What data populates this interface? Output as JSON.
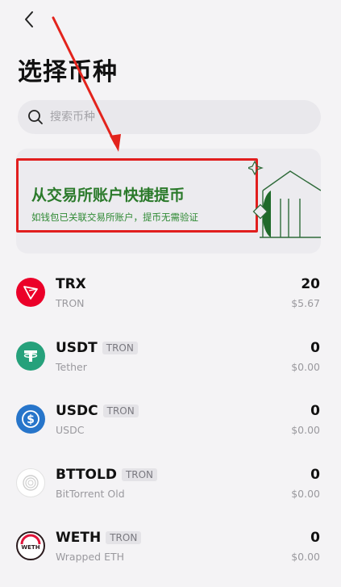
{
  "header": {
    "title": "选择币种"
  },
  "search": {
    "placeholder": "搜索币种"
  },
  "banner": {
    "title": "从交易所账户快捷提币",
    "subtitle": "如钱包已关联交易所账户，提币无需验证",
    "highlight_color": "#e11e1e",
    "text_color": "#2b7a2b"
  },
  "tokens": [
    {
      "symbol": "TRX",
      "chain": "",
      "name": "TRON",
      "amount": "20",
      "value": "$5.67",
      "icon": "tron-icon",
      "color": "#eb0029"
    },
    {
      "symbol": "USDT",
      "chain": "TRON",
      "name": "Tether",
      "amount": "0",
      "value": "$0.00",
      "icon": "tether-icon",
      "color": "#26a17b"
    },
    {
      "symbol": "USDC",
      "chain": "TRON",
      "name": "USDC",
      "amount": "0",
      "value": "$0.00",
      "icon": "usdc-icon",
      "color": "#2775ca"
    },
    {
      "symbol": "BTTOLD",
      "chain": "TRON",
      "name": "BitTorrent Old",
      "amount": "0",
      "value": "$0.00",
      "icon": "bittorrent-icon",
      "color": "#d8d8d8"
    },
    {
      "symbol": "WETH",
      "chain": "TRON",
      "name": "Wrapped ETH",
      "amount": "0",
      "value": "$0.00",
      "icon": "weth-icon",
      "color": "#2b1b1e"
    }
  ]
}
